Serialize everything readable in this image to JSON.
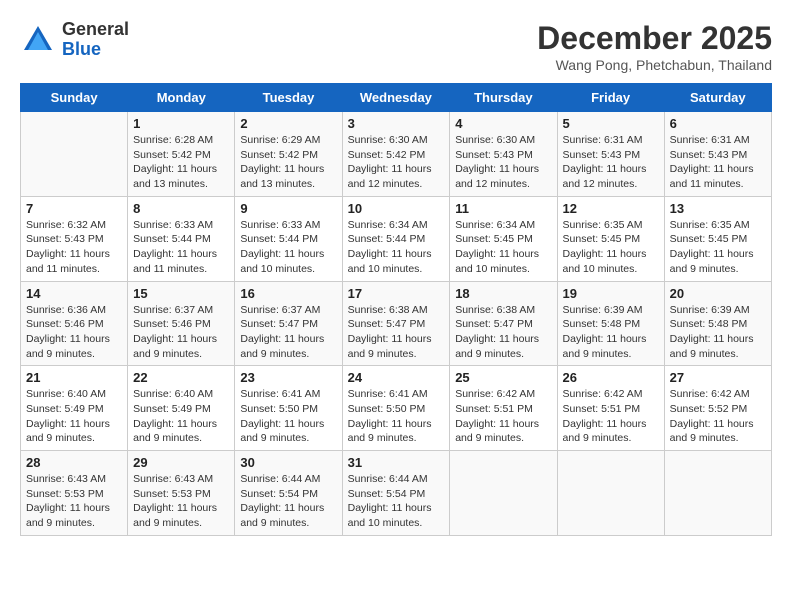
{
  "logo": {
    "general": "General",
    "blue": "Blue"
  },
  "title": "December 2025",
  "subtitle": "Wang Pong, Phetchabun, Thailand",
  "days_of_week": [
    "Sunday",
    "Monday",
    "Tuesday",
    "Wednesday",
    "Thursday",
    "Friday",
    "Saturday"
  ],
  "weeks": [
    [
      {
        "num": "",
        "info": ""
      },
      {
        "num": "1",
        "info": "Sunrise: 6:28 AM\nSunset: 5:42 PM\nDaylight: 11 hours\nand 13 minutes."
      },
      {
        "num": "2",
        "info": "Sunrise: 6:29 AM\nSunset: 5:42 PM\nDaylight: 11 hours\nand 13 minutes."
      },
      {
        "num": "3",
        "info": "Sunrise: 6:30 AM\nSunset: 5:42 PM\nDaylight: 11 hours\nand 12 minutes."
      },
      {
        "num": "4",
        "info": "Sunrise: 6:30 AM\nSunset: 5:43 PM\nDaylight: 11 hours\nand 12 minutes."
      },
      {
        "num": "5",
        "info": "Sunrise: 6:31 AM\nSunset: 5:43 PM\nDaylight: 11 hours\nand 12 minutes."
      },
      {
        "num": "6",
        "info": "Sunrise: 6:31 AM\nSunset: 5:43 PM\nDaylight: 11 hours\nand 11 minutes."
      }
    ],
    [
      {
        "num": "7",
        "info": "Sunrise: 6:32 AM\nSunset: 5:43 PM\nDaylight: 11 hours\nand 11 minutes."
      },
      {
        "num": "8",
        "info": "Sunrise: 6:33 AM\nSunset: 5:44 PM\nDaylight: 11 hours\nand 11 minutes."
      },
      {
        "num": "9",
        "info": "Sunrise: 6:33 AM\nSunset: 5:44 PM\nDaylight: 11 hours\nand 10 minutes."
      },
      {
        "num": "10",
        "info": "Sunrise: 6:34 AM\nSunset: 5:44 PM\nDaylight: 11 hours\nand 10 minutes."
      },
      {
        "num": "11",
        "info": "Sunrise: 6:34 AM\nSunset: 5:45 PM\nDaylight: 11 hours\nand 10 minutes."
      },
      {
        "num": "12",
        "info": "Sunrise: 6:35 AM\nSunset: 5:45 PM\nDaylight: 11 hours\nand 10 minutes."
      },
      {
        "num": "13",
        "info": "Sunrise: 6:35 AM\nSunset: 5:45 PM\nDaylight: 11 hours\nand 9 minutes."
      }
    ],
    [
      {
        "num": "14",
        "info": "Sunrise: 6:36 AM\nSunset: 5:46 PM\nDaylight: 11 hours\nand 9 minutes."
      },
      {
        "num": "15",
        "info": "Sunrise: 6:37 AM\nSunset: 5:46 PM\nDaylight: 11 hours\nand 9 minutes."
      },
      {
        "num": "16",
        "info": "Sunrise: 6:37 AM\nSunset: 5:47 PM\nDaylight: 11 hours\nand 9 minutes."
      },
      {
        "num": "17",
        "info": "Sunrise: 6:38 AM\nSunset: 5:47 PM\nDaylight: 11 hours\nand 9 minutes."
      },
      {
        "num": "18",
        "info": "Sunrise: 6:38 AM\nSunset: 5:47 PM\nDaylight: 11 hours\nand 9 minutes."
      },
      {
        "num": "19",
        "info": "Sunrise: 6:39 AM\nSunset: 5:48 PM\nDaylight: 11 hours\nand 9 minutes."
      },
      {
        "num": "20",
        "info": "Sunrise: 6:39 AM\nSunset: 5:48 PM\nDaylight: 11 hours\nand 9 minutes."
      }
    ],
    [
      {
        "num": "21",
        "info": "Sunrise: 6:40 AM\nSunset: 5:49 PM\nDaylight: 11 hours\nand 9 minutes."
      },
      {
        "num": "22",
        "info": "Sunrise: 6:40 AM\nSunset: 5:49 PM\nDaylight: 11 hours\nand 9 minutes."
      },
      {
        "num": "23",
        "info": "Sunrise: 6:41 AM\nSunset: 5:50 PM\nDaylight: 11 hours\nand 9 minutes."
      },
      {
        "num": "24",
        "info": "Sunrise: 6:41 AM\nSunset: 5:50 PM\nDaylight: 11 hours\nand 9 minutes."
      },
      {
        "num": "25",
        "info": "Sunrise: 6:42 AM\nSunset: 5:51 PM\nDaylight: 11 hours\nand 9 minutes."
      },
      {
        "num": "26",
        "info": "Sunrise: 6:42 AM\nSunset: 5:51 PM\nDaylight: 11 hours\nand 9 minutes."
      },
      {
        "num": "27",
        "info": "Sunrise: 6:42 AM\nSunset: 5:52 PM\nDaylight: 11 hours\nand 9 minutes."
      }
    ],
    [
      {
        "num": "28",
        "info": "Sunrise: 6:43 AM\nSunset: 5:53 PM\nDaylight: 11 hours\nand 9 minutes."
      },
      {
        "num": "29",
        "info": "Sunrise: 6:43 AM\nSunset: 5:53 PM\nDaylight: 11 hours\nand 9 minutes."
      },
      {
        "num": "30",
        "info": "Sunrise: 6:44 AM\nSunset: 5:54 PM\nDaylight: 11 hours\nand 9 minutes."
      },
      {
        "num": "31",
        "info": "Sunrise: 6:44 AM\nSunset: 5:54 PM\nDaylight: 11 hours\nand 10 minutes."
      },
      {
        "num": "",
        "info": ""
      },
      {
        "num": "",
        "info": ""
      },
      {
        "num": "",
        "info": ""
      }
    ]
  ]
}
